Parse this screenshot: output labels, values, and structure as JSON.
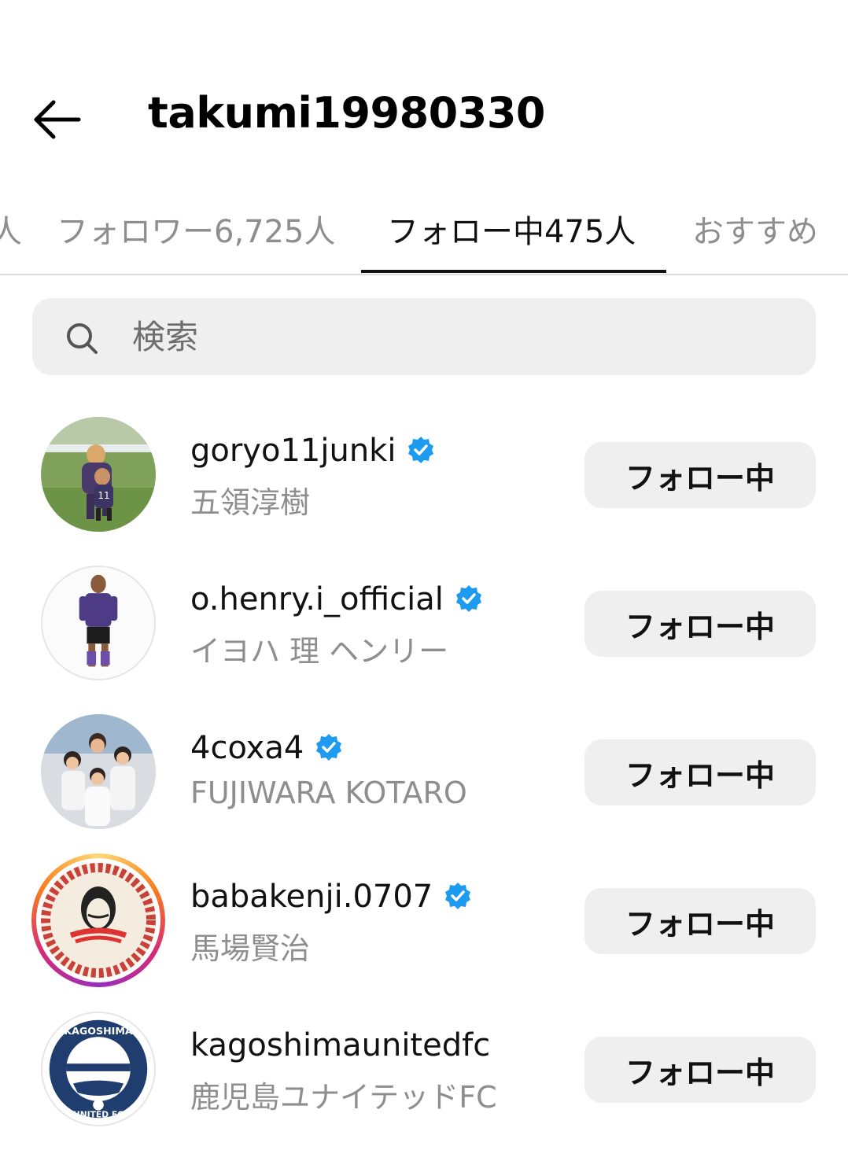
{
  "header": {
    "title": "takumi19980330"
  },
  "tabs": [
    {
      "label": "人",
      "active": false
    },
    {
      "label": "フォロワー6,725人",
      "active": false
    },
    {
      "label": "フォロー中475人",
      "active": true
    },
    {
      "label": "おすすめ",
      "active": false
    }
  ],
  "search": {
    "placeholder": "検索"
  },
  "accounts": [
    {
      "username": "goryo11junki",
      "full_name": "五領淳樹",
      "verified": true,
      "button_label": "フォロー中"
    },
    {
      "username": "o.henry.i_official",
      "full_name": "イヨハ 理 ヘンリー",
      "verified": true,
      "button_label": "フォロー中"
    },
    {
      "username": "4coxa4",
      "full_name": "FUJIWARA KOTARO",
      "verified": true,
      "button_label": "フォロー中"
    },
    {
      "username": "babakenji.0707",
      "full_name": "馬場賢治",
      "verified": true,
      "has_story": true,
      "button_label": "フォロー中"
    },
    {
      "username": "kagoshimaunitedfc",
      "full_name": "鹿児島ユナイテッドFC",
      "verified": false,
      "button_label": "フォロー中"
    }
  ],
  "logo_text": {
    "kagoshima_top": "KAGOSHIMA",
    "kagoshima_bottom": "UNITED FC"
  },
  "colors": {
    "verified_blue": "#1d9bf0",
    "button_bg": "#efefef",
    "secondary_text": "#8e8e8e"
  }
}
